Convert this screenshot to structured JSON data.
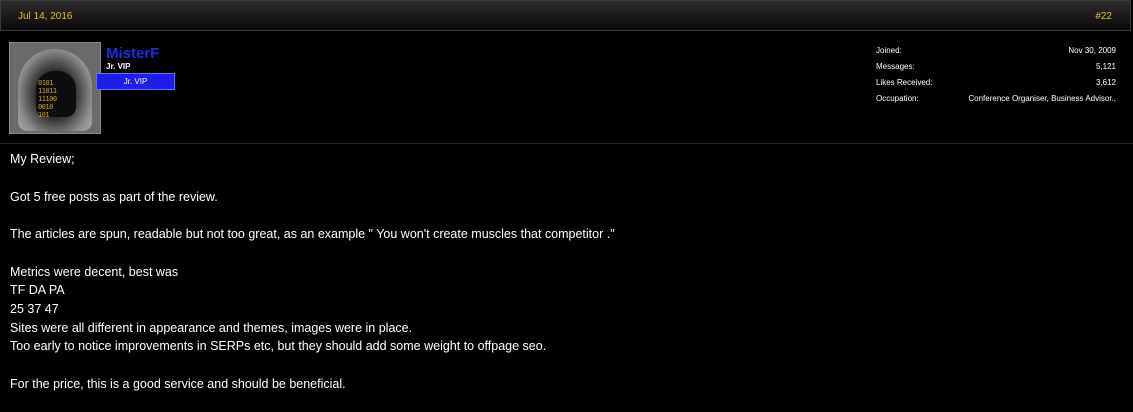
{
  "header": {
    "date": "Jul 14, 2016",
    "post_number": "#22"
  },
  "user": {
    "name": "MisterF",
    "title": "Jr. VIP",
    "banner": "Jr. VIP",
    "avatar_binary": [
      "0101",
      "11011",
      "11100",
      "0010",
      "101"
    ]
  },
  "stats": [
    {
      "label": "Joined:",
      "value": "Nov 30, 2009"
    },
    {
      "label": "Messages:",
      "value": "5,121"
    },
    {
      "label": "Likes Received:",
      "value": "3,612"
    },
    {
      "label": "Occupation:",
      "value": "Conference Organiser, Business Advisor.,"
    }
  ],
  "message": {
    "line1": "My Review;",
    "line2": "Got 5 free posts as part of the review.",
    "line3": "The articles are spun, readable but not too great, as an example \" You won't create muscles that competitor .\"",
    "line4": "Metrics were decent, best was",
    "line5": "TF DA PA",
    "line6": "25 37 47",
    "line7": "Sites were all different in appearance and themes, images were in place.",
    "line8": "Too early to notice improvements in SERPs etc, but they should add some weight to offpage seo.",
    "line9": "For the price, this is a good service and should be beneficial."
  }
}
